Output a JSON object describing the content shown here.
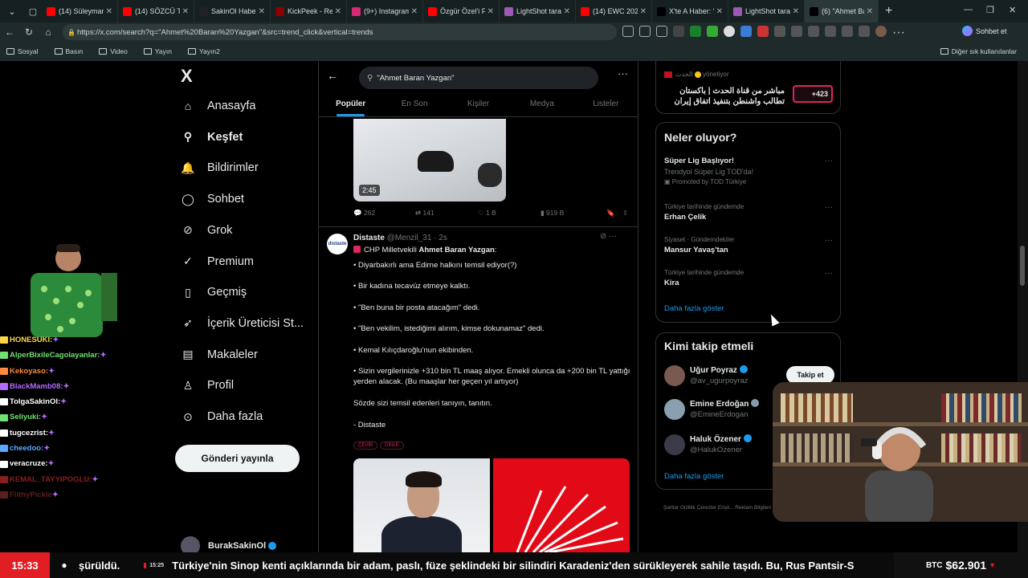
{
  "browser": {
    "tabs": [
      {
        "label": "(14) Süleymancıla",
        "color": "#ff0000"
      },
      {
        "label": "(14) SÖZCÜ TV C",
        "color": "#ff0000"
      },
      {
        "label": "SakinOl Haber M",
        "color": "#222222"
      },
      {
        "label": "KickPeek - Real-t",
        "color": "#8b0000"
      },
      {
        "label": "(9+) Instagram",
        "color": "#d62976"
      },
      {
        "label": "Özgür Özel'i Fetö",
        "color": "#ff0000"
      },
      {
        "label": "LightShot tarafın",
        "color": "#9b59b6"
      },
      {
        "label": "(14) EWC 2026 -",
        "color": "#ff0000"
      },
      {
        "label": "X'te A Haber: \"Al",
        "color": "#000000"
      },
      {
        "label": "LightShot tarafın",
        "color": "#9b59b6"
      },
      {
        "label": "(6) \"Ahmet Baran",
        "color": "#000000"
      }
    ],
    "url": "https://x.com/search?q=\"Ahmet%20Baran%20Yazgan\"&src=trend_click&vertical=trends",
    "sohbet_label": "Sohbet et",
    "bookmarks": [
      "Sosyal",
      "Basın",
      "Video",
      "Yayın",
      "Yayın2"
    ],
    "other_bookmarks": "Diğer sık kullanılanlar"
  },
  "nav": {
    "logo": "X",
    "items": [
      {
        "label": "Anasayfa",
        "icon": "home-icon"
      },
      {
        "label": "Keşfet",
        "icon": "search-icon"
      },
      {
        "label": "Bildirimler",
        "icon": "bell-icon"
      },
      {
        "label": "Sohbet",
        "icon": "chat-icon"
      },
      {
        "label": "Grok",
        "icon": "grok-icon"
      },
      {
        "label": "Premium",
        "icon": "premium-icon"
      },
      {
        "label": "Geçmiş",
        "icon": "bookmark-icon"
      },
      {
        "label": "İçerik Üreticisi St...",
        "icon": "rocket-icon"
      },
      {
        "label": "Makaleler",
        "icon": "article-icon"
      },
      {
        "label": "Profil",
        "icon": "person-icon"
      },
      {
        "label": "Daha fazla",
        "icon": "more-circle-icon"
      }
    ],
    "post_button": "Gönderi yayınla",
    "account_name": "BurakSakinOl"
  },
  "search": {
    "query": "\"Ahmet Baran Yazgan\"",
    "tabs": [
      "Popüler",
      "En Son",
      "Kişiler",
      "Medya",
      "Listeler"
    ]
  },
  "prev_post": {
    "duration": "2:45",
    "replies": "262",
    "reposts": "141",
    "likes": "1 B",
    "views": "919 B"
  },
  "tweet": {
    "author": "Distaste",
    "handle": "@Menzil_31 · 2s",
    "avatar_text": "distaste",
    "headline_prefix": "CHP Milletvekili ",
    "headline_name": "Ahmet Baran Yazgan",
    "headline_suffix": ":",
    "lines": [
      "• Diyarbakırlı ama Edirne halkını temsil ediyor(?)",
      "• Bir kadına tecavüz etmeye kalktı.",
      "• \"Ben buna bir posta atacağım\" dedi.",
      "• \"Ben vekilim, istediğimi alırım, kimse dokunamaz\" dedi.",
      "• Kemal Kılıçdaroğlu'nun ekibinden.",
      "• Sizin vergilerinizle +310 bin TL maaş alıyor. Emekli olunca da +200 bin TL yattığı yerden alacak. (Bu maaşlar her geçen yıl artıyor)",
      "Sözde sizi temsil edenleri tanıyın, tanıtın.",
      "- Distaste"
    ],
    "tags": [
      "ÇEVİR",
      "DİNLE"
    ]
  },
  "ad": {
    "source": "الحدث",
    "managed": "yönetiyor",
    "text": "مباشر من قناة الحدث | باكستان تطالب واشنطن بتنفيذ اتفاق إيران",
    "badge": "+423"
  },
  "trends": {
    "title": "Neler oluyor?",
    "items": [
      {
        "meta": "",
        "name": "Süper Lig Başlıyor!",
        "sub": "Trendyol Süper Lig TOD'da!",
        "promo": "Promoted by TOD Türkiye"
      },
      {
        "meta": "Türkiye tarihinde gündemde",
        "name": "Erhan Çelik"
      },
      {
        "meta": "Siyaset · Gündemdekiler",
        "name": "Mansur Yavaş'tan"
      },
      {
        "meta": "Türkiye tarihinde gündemde",
        "name": "Kira"
      }
    ],
    "show_more": "Daha fazla göster"
  },
  "who_to_follow": {
    "title": "Kimi takip etmeli",
    "follow_label": "Takip et",
    "people": [
      {
        "name": "Uğur Poyraz",
        "handle": "@av_ugurpoyraz"
      },
      {
        "name": "Emine Erdoğan",
        "handle": "@EmineErdogan"
      },
      {
        "name": "Haluk Özener",
        "handle": "@HalukOzener"
      }
    ],
    "show_more": "Daha fazla göster"
  },
  "footer": "Şartlar   Gizlilik   Çerezler   Erişil...   Reklam Bilgileri   Daha fazla ···   © 2026 X Co...",
  "chat": [
    {
      "user": "HONESUKI:",
      "color": "#ffd447"
    },
    {
      "user": "AlperBixileCagolayanlar:",
      "color": "#6fe26f"
    },
    {
      "user": "Kekoyaso:",
      "color": "#ff8a3d"
    },
    {
      "user": "BlackMamb08:",
      "color": "#b46bff"
    },
    {
      "user": "TolgaSakinOl:",
      "color": "#ffffff"
    },
    {
      "user": "Seliyuki:",
      "color": "#6fe26f"
    },
    {
      "user": "tugcezrist:",
      "color": "#ffffff"
    },
    {
      "user": "cheedoo:",
      "color": "#5aa7ff"
    },
    {
      "user": "veracruze:",
      "color": "#ffffff"
    },
    {
      "user": "KEMAL_TAYYIPOGLU:",
      "color": "#8b1d1d"
    },
    {
      "user": "FilthyPickle",
      "color": "#5a1f1f"
    }
  ],
  "ticker": {
    "time": "15:33",
    "text_lead": "şürüldü.",
    "mini_time": "15:25",
    "text": "Türkiye'nin Sinop kenti açıklarında bir adam, paslı, füze şeklindeki bir silindiri Karadeniz'den sürükleyerek sahile taşıdı. Bu, Rus Pantsir-S",
    "btc_label": "BTC",
    "btc_value": "$62.901"
  }
}
